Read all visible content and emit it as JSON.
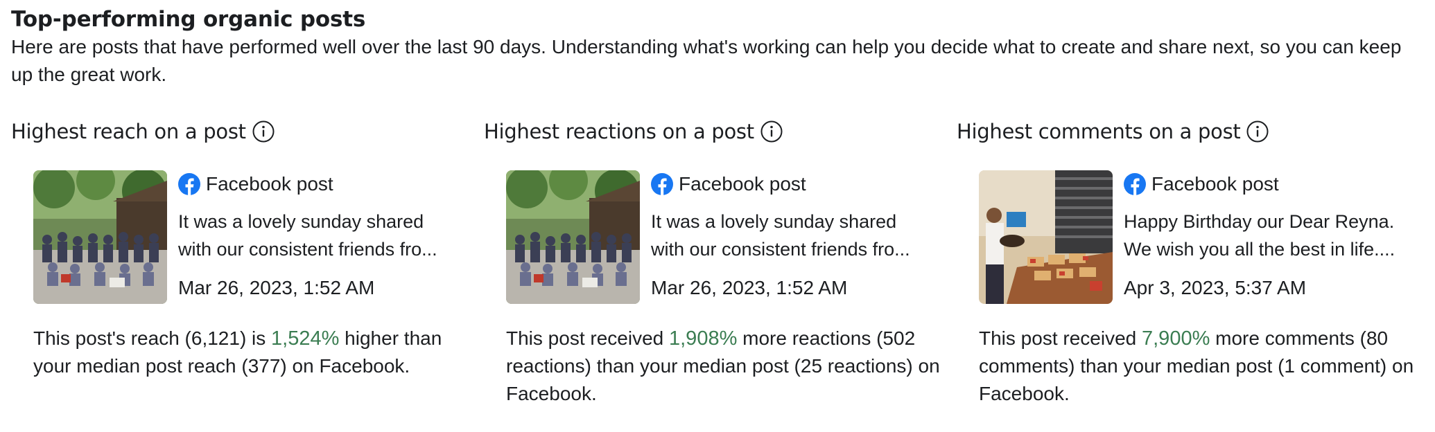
{
  "section": {
    "title": "Top-performing organic posts",
    "description": "Here are posts that have performed well over the last 90 days. Understanding what's working can help you decide what to create and share next, so you can keep up the great work."
  },
  "colors": {
    "highlight": "#3b7d52",
    "facebook_blue": "#1877f2",
    "text": "#1c1e21"
  },
  "columns": [
    {
      "title": "Highest reach on a post",
      "info_icon": "info-icon",
      "post": {
        "type_label": "Facebook post",
        "type_icon": "facebook-icon",
        "text_line1": "It was a lovely sunday shared",
        "text_line2": "with our consistent friends fro...",
        "date": "Mar 26, 2023, 1:52 AM",
        "thumbnail": "group-photo-outdoors"
      },
      "insight": {
        "prefix": "This post's reach (6,121) is ",
        "highlight": "1,524%",
        "suffix": " higher than your median post reach (377) on Facebook."
      }
    },
    {
      "title": "Highest reactions on a post",
      "info_icon": "info-icon",
      "post": {
        "type_label": "Facebook post",
        "type_icon": "facebook-icon",
        "text_line1": "It was a lovely sunday shared",
        "text_line2": "with our consistent friends fro...",
        "date": "Mar 26, 2023, 1:52 AM",
        "thumbnail": "group-photo-outdoors"
      },
      "insight": {
        "prefix": "This post received ",
        "highlight": "1,908%",
        "suffix": " more reactions (502 reactions) than your median post (25 reactions) on Facebook."
      }
    },
    {
      "title": "Highest comments on a post",
      "info_icon": "info-icon",
      "post": {
        "type_label": "Facebook post",
        "type_icon": "facebook-icon",
        "text_line1": "Happy Birthday our Dear Reyna.",
        "text_line2": "We wish you all the best in life....",
        "date": "Apr 3, 2023, 5:37 AM",
        "thumbnail": "birthday-party-photo"
      },
      "insight": {
        "prefix": "This post received ",
        "highlight": "7,900%",
        "suffix": " more comments (80 comments) than your median post (1 comment) on Facebook."
      }
    }
  ]
}
